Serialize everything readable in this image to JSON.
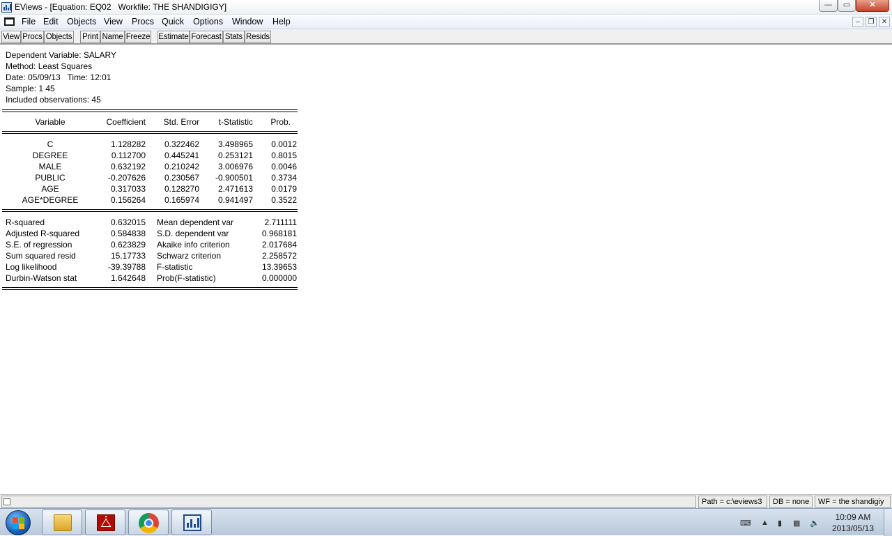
{
  "window": {
    "title": "EViews - [Equation: EQ02   Workfile: THE SHANDIGIGY]",
    "minimize_label": "—",
    "maximize_label": "▭",
    "close_label": "✕"
  },
  "menubar": {
    "items": [
      "File",
      "Edit",
      "Objects",
      "View",
      "Procs",
      "Quick",
      "Options",
      "Window",
      "Help"
    ],
    "child_minimize": "–",
    "child_restore": "❐",
    "child_close": "✕"
  },
  "toolbar": {
    "buttons": [
      "View",
      "Procs",
      "Objects",
      "Print",
      "Name",
      "Freeze",
      "Estimate",
      "Forecast",
      "Stats",
      "Resids"
    ]
  },
  "output": {
    "header": [
      "Dependent Variable: SALARY",
      "Method: Least Squares",
      "Date: 05/09/13   Time: 12:01",
      "Sample: 1 45",
      "Included observations: 45"
    ],
    "columns": [
      "Variable",
      "Coefficient",
      "Std. Error",
      "t-Statistic",
      "Prob."
    ],
    "coefficients": [
      {
        "variable": "C",
        "coefficient": "1.128282",
        "std_error": "0.322462",
        "t_stat": "3.498965",
        "prob": "0.0012"
      },
      {
        "variable": "DEGREE",
        "coefficient": "0.112700",
        "std_error": "0.445241",
        "t_stat": "0.253121",
        "prob": "0.8015"
      },
      {
        "variable": "MALE",
        "coefficient": "0.632192",
        "std_error": "0.210242",
        "t_stat": "3.006976",
        "prob": "0.0046"
      },
      {
        "variable": "PUBLIC",
        "coefficient": "-0.207626",
        "std_error": "0.230567",
        "t_stat": "-0.900501",
        "prob": "0.3734"
      },
      {
        "variable": "AGE",
        "coefficient": "0.317033",
        "std_error": "0.128270",
        "t_stat": "2.471613",
        "prob": "0.0179"
      },
      {
        "variable": "AGE*DEGREE",
        "coefficient": "0.156264",
        "std_error": "0.165974",
        "t_stat": "0.941497",
        "prob": "0.3522"
      }
    ],
    "stats": [
      {
        "label": "R-squared",
        "value": "0.632015",
        "label2": "Mean dependent var",
        "value2": "2.711111"
      },
      {
        "label": "Adjusted R-squared",
        "value": "0.584838",
        "label2": "S.D. dependent var",
        "value2": "0.968181"
      },
      {
        "label": "S.E. of regression",
        "value": "0.623829",
        "label2": "Akaike info criterion",
        "value2": "2.017684"
      },
      {
        "label": "Sum squared resid",
        "value": "15.17733",
        "label2": "Schwarz criterion",
        "value2": "2.258572"
      },
      {
        "label": "Log likelihood",
        "value": "-39.39788",
        "label2": "F-statistic",
        "value2": "13.39653"
      },
      {
        "label": "Durbin-Watson stat",
        "value": "1.642648",
        "label2": "Prob(F-statistic)",
        "value2": "0.000000"
      }
    ]
  },
  "statusbar": {
    "path": "Path = c:\\eviews3",
    "db": "DB = none",
    "wf": "WF = the shandigiy"
  },
  "taskbar": {
    "apps": [
      "windows-explorer-icon",
      "adobe-reader-icon",
      "chrome-icon",
      "eviews-icon"
    ],
    "time": "10:09 AM",
    "date": "2013/05/13"
  }
}
